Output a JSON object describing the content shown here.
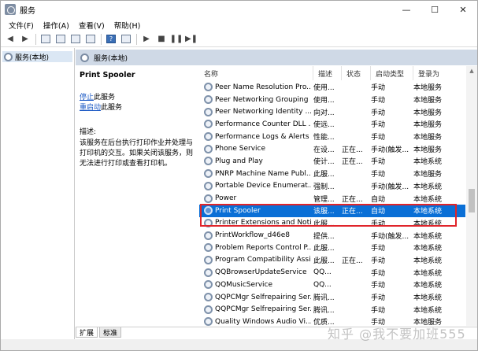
{
  "window": {
    "title": "服务",
    "minimize": "—",
    "maximize": "☐",
    "close": "✕"
  },
  "menu": [
    "文件(F)",
    "操作(A)",
    "查看(V)",
    "帮助(H)"
  ],
  "tree": {
    "root_label": "服务(本地)"
  },
  "header": {
    "title": "服务(本地)"
  },
  "details": {
    "service_name": "Print Spooler",
    "stop_link": "停止",
    "stop_suffix": "此服务",
    "restart_link": "重启动",
    "restart_suffix": "此服务",
    "desc_label": "描述:",
    "desc_text": "该服务在后台执行打印作业并处理与打印机的交互。如果关闭该服务，则无法进行打印或查看打印机。"
  },
  "columns": {
    "name": "名称",
    "description": "描述",
    "status": "状态",
    "startup": "启动类型",
    "logon": "登录为"
  },
  "services": [
    {
      "name": "Peer Name Resolution Pro...",
      "description": "使用...",
      "status": "",
      "startup": "手动",
      "logon": "本地服务"
    },
    {
      "name": "Peer Networking Grouping",
      "description": "使用...",
      "status": "",
      "startup": "手动",
      "logon": "本地服务"
    },
    {
      "name": "Peer Networking Identity ...",
      "description": "向对...",
      "status": "",
      "startup": "手动",
      "logon": "本地服务"
    },
    {
      "name": "Performance Counter DLL ...",
      "description": "使远...",
      "status": "",
      "startup": "手动",
      "logon": "本地服务"
    },
    {
      "name": "Performance Logs & Alerts",
      "description": "性能...",
      "status": "",
      "startup": "手动",
      "logon": "本地服务"
    },
    {
      "name": "Phone Service",
      "description": "在设...",
      "status": "正在...",
      "startup": "手动(触发...",
      "logon": "本地服务"
    },
    {
      "name": "Plug and Play",
      "description": "使计...",
      "status": "正在...",
      "startup": "手动",
      "logon": "本地系统"
    },
    {
      "name": "PNRP Machine Name Publ...",
      "description": "此服...",
      "status": "",
      "startup": "手动",
      "logon": "本地服务"
    },
    {
      "name": "Portable Device Enumerat...",
      "description": "强制...",
      "status": "",
      "startup": "手动(触发...",
      "logon": "本地系统"
    },
    {
      "name": "Power",
      "description": "管理...",
      "status": "正在...",
      "startup": "自动",
      "logon": "本地系统"
    },
    {
      "name": "Print Spooler",
      "description": "该服...",
      "status": "正在...",
      "startup": "自动",
      "logon": "本地系统",
      "selected": true
    },
    {
      "name": "Printer Extensions and Noti...",
      "description": "此服...",
      "status": "",
      "startup": "手动",
      "logon": "本地系统"
    },
    {
      "name": "PrintWorkflow_d46e8",
      "description": "提供...",
      "status": "",
      "startup": "手动(触发...",
      "logon": "本地系统"
    },
    {
      "name": "Problem Reports Control P...",
      "description": "此服...",
      "status": "",
      "startup": "手动",
      "logon": "本地系统"
    },
    {
      "name": "Program Compatibility Assi...",
      "description": "此服...",
      "status": "正在...",
      "startup": "手动",
      "logon": "本地系统"
    },
    {
      "name": "QQBrowserUpdateService",
      "description": "QQ...",
      "status": "",
      "startup": "手动",
      "logon": "本地系统"
    },
    {
      "name": "QQMusicService",
      "description": "QQ...",
      "status": "",
      "startup": "手动",
      "logon": "本地系统"
    },
    {
      "name": "QQPCMgr Selfrepairing Ser...",
      "description": "腾讯...",
      "status": "",
      "startup": "手动",
      "logon": "本地系统"
    },
    {
      "name": "QQPCMgr Selfrepairing Ser...",
      "description": "腾讯...",
      "status": "",
      "startup": "手动",
      "logon": "本地系统"
    },
    {
      "name": "Quality Windows Audio Vi...",
      "description": "优质...",
      "status": "",
      "startup": "手动",
      "logon": "本地服务"
    }
  ],
  "tabs": [
    "扩展",
    "标准"
  ],
  "watermark": "知乎 @我不要加班555",
  "colors": {
    "selection": "#0a6fd6",
    "highlight_border": "#e0242a",
    "header_bg": "#cfd9e6"
  }
}
